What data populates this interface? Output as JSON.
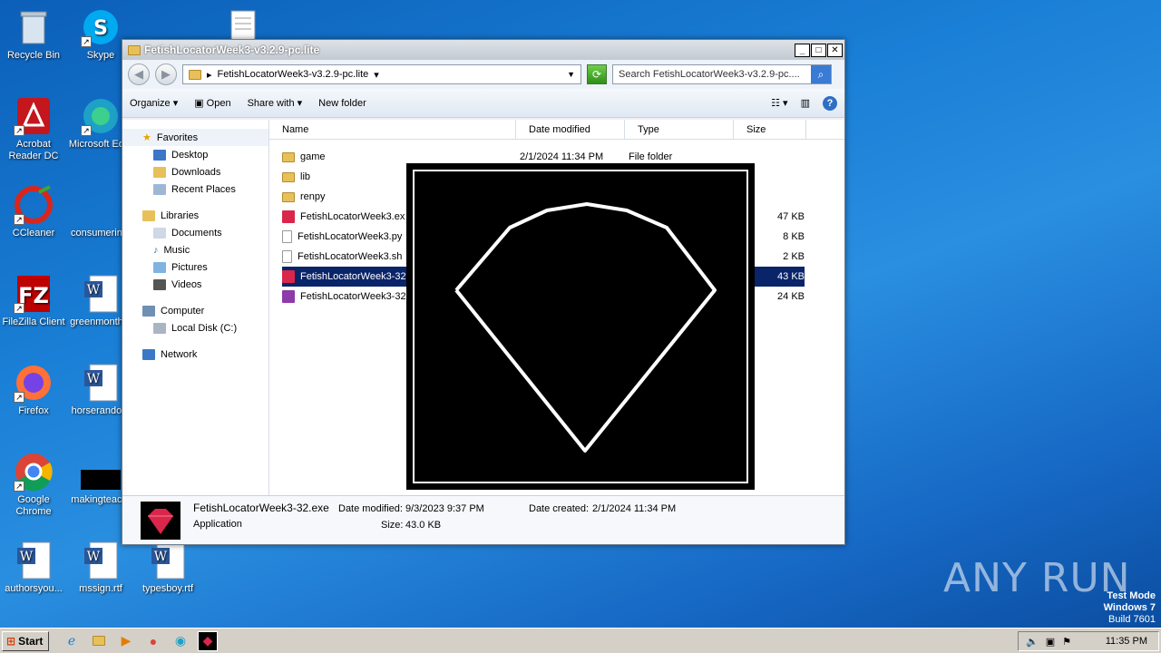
{
  "desktop": {
    "icons": [
      {
        "label": "Recycle Bin"
      },
      {
        "label": "Skype"
      },
      {
        "label": "Acrobat Reader DC"
      },
      {
        "label": "Microsoft Ed..."
      },
      {
        "label": "CCleaner"
      },
      {
        "label": "consumerin..."
      },
      {
        "label": "FileZilla Client"
      },
      {
        "label": "greenmonth..."
      },
      {
        "label": "Firefox"
      },
      {
        "label": "horserando..."
      },
      {
        "label": "Google Chrome"
      },
      {
        "label": "makingteac..."
      },
      {
        "label": "authorsyou..."
      },
      {
        "label": "mssign.rtf"
      },
      {
        "label": "typesboy.rtf"
      }
    ]
  },
  "window": {
    "title": "FetishLocatorWeek3-v3.2.9-pc.lite",
    "address": "FetishLocatorWeek3-v3.2.9-pc.lite",
    "search_placeholder": "Search FetishLocatorWeek3-v3.2.9-pc....",
    "buttons": {
      "min": "_",
      "max": "□",
      "close": "✕"
    }
  },
  "toolbar": {
    "organize": "Organize ▾",
    "open": "Open",
    "share": "Share with ▾",
    "new_folder": "New folder"
  },
  "nav": {
    "favorites": "Favorites",
    "desktop": "Desktop",
    "downloads": "Downloads",
    "recent": "Recent Places",
    "libraries": "Libraries",
    "documents": "Documents",
    "music": "Music",
    "pictures": "Pictures",
    "videos": "Videos",
    "computer": "Computer",
    "local_disk": "Local Disk (C:)",
    "network": "Network"
  },
  "columns": {
    "name": "Name",
    "date": "Date modified",
    "type": "Type",
    "size": "Size"
  },
  "files": [
    {
      "name": "game",
      "date": "2/1/2024 11:34 PM",
      "type": "File folder",
      "size": ""
    },
    {
      "name": "lib",
      "date": "",
      "type": "",
      "size": ""
    },
    {
      "name": "renpy",
      "date": "",
      "type": "",
      "size": ""
    },
    {
      "name": "FetishLocatorWeek3.ex",
      "date": "",
      "type": "",
      "size": "47 KB"
    },
    {
      "name": "FetishLocatorWeek3.py",
      "date": "",
      "type": "",
      "size": "8 KB"
    },
    {
      "name": "FetishLocatorWeek3.sh",
      "date": "",
      "type": "",
      "size": "2 KB"
    },
    {
      "name": "FetishLocatorWeek3-32",
      "date": "",
      "type": "",
      "size": "43 KB"
    },
    {
      "name": "FetishLocatorWeek3-32",
      "date": "",
      "type": "",
      "size": "24 KB"
    }
  ],
  "details": {
    "filename": "FetishLocatorWeek3-32.exe",
    "kind": "Application",
    "date_modified_label": "Date modified:",
    "date_modified": "9/3/2023 9:37 PM",
    "size_label": "Size:",
    "size": "43.0 KB",
    "date_created_label": "Date created:",
    "date_created": "2/1/2024 11:34 PM"
  },
  "taskbar": {
    "start": "Start",
    "clock": "11:35 PM"
  },
  "watermark": {
    "line1": "Test Mode",
    "line2": "Windows 7",
    "line3": "Build 7601",
    "brand": "ANY RUN"
  },
  "colors": {
    "selection": "#0a246a",
    "accent": "#2e6fc5",
    "gem": "#d9264a"
  }
}
